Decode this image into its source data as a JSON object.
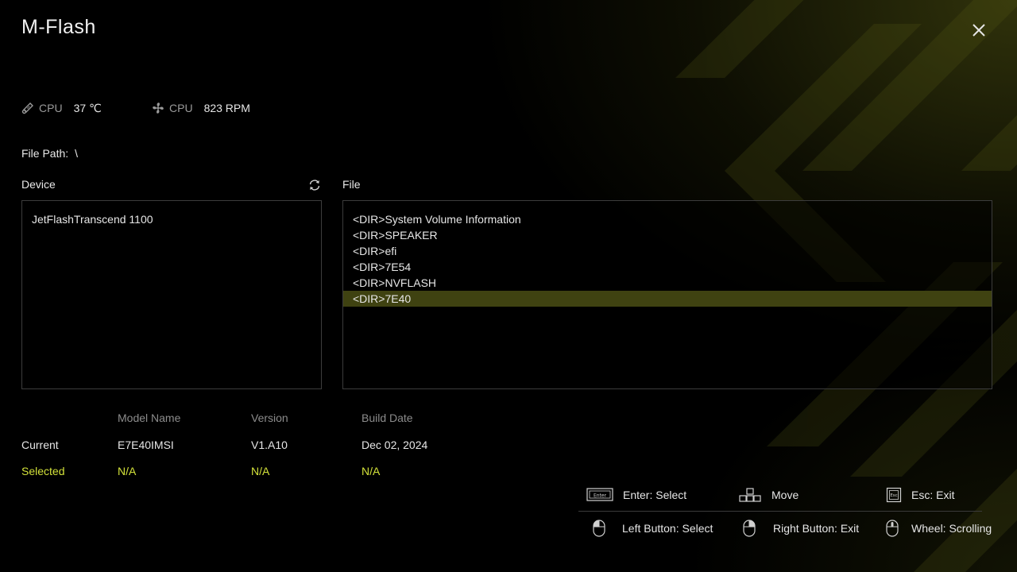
{
  "app": {
    "title": "M-Flash"
  },
  "sensors": [
    {
      "label": "CPU",
      "value": "37 ℃",
      "icon": "thermometer-icon"
    },
    {
      "label": "CPU",
      "value": "823 RPM",
      "icon": "fan-icon"
    }
  ],
  "file_path": {
    "label": "File Path:",
    "value": "\\"
  },
  "device_panel": {
    "label": "Device",
    "items": [
      "JetFlashTranscend 1100"
    ]
  },
  "file_panel": {
    "label": "File",
    "items": [
      "<DIR>System Volume Information",
      "<DIR>SPEAKER",
      "<DIR>efi",
      "<DIR>7E54",
      "<DIR>NVFLASH",
      "<DIR>7E40"
    ],
    "selected_index": 5
  },
  "bios_info": {
    "headers": [
      "Model Name",
      "Version",
      "Build Date"
    ],
    "current": {
      "label": "Current",
      "model": "E7E40IMSI",
      "version": "V1.A10",
      "date": "Dec 02, 2024"
    },
    "selected": {
      "label": "Selected",
      "model": "N/A",
      "version": "N/A",
      "date": "N/A"
    }
  },
  "help": {
    "enter": "Enter: Select",
    "move": "Move",
    "esc": "Esc: Exit",
    "left_button": "Left Button: Select",
    "right_button": "Right Button: Exit",
    "wheel": "Wheel: Scrolling",
    "enter_key_caption": "Enter",
    "esc_key_caption": "Esc"
  },
  "colors": {
    "accent": "#d3e23a",
    "selected_row": "#3f4211",
    "panel_border": "#3c3c3c"
  }
}
